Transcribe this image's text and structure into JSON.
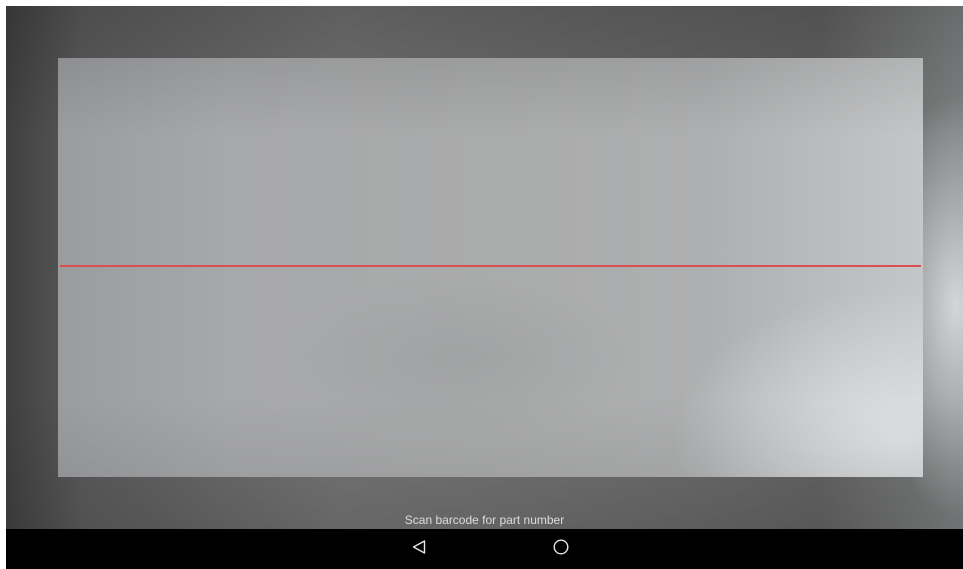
{
  "scanner": {
    "prompt": "Scan barcode for part number",
    "scan_line_color": "#d8504f"
  },
  "navbar": {
    "buttons": [
      {
        "icon": "back-icon"
      },
      {
        "icon": "home-icon"
      }
    ]
  }
}
